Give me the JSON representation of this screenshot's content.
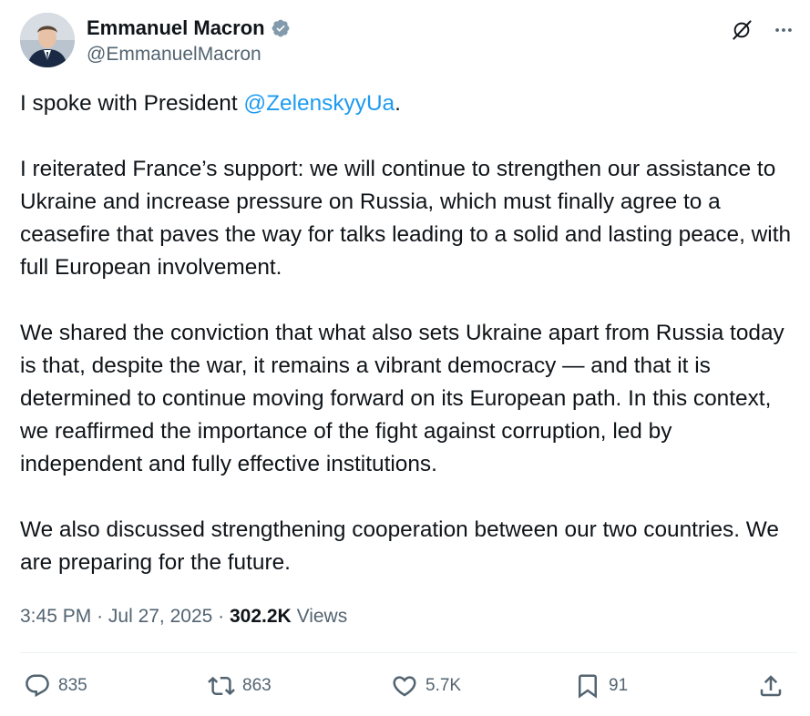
{
  "author": {
    "display_name": "Emmanuel Macron",
    "handle": "@EmmanuelMacron",
    "verified": true,
    "avatar_icon": "avatar"
  },
  "tweet": {
    "p1_prefix": "I spoke with President ",
    "p1_mention": "@ZelenskyyUa",
    "p1_suffix": ".",
    "p2": "I reiterated France’s support: we will continue to strengthen our assistance to Ukraine and increase pressure on Russia, which must finally agree to a ceasefire that paves the way for talks leading to a solid and lasting peace, with full European involvement.",
    "p3": "We shared the conviction that what also sets Ukraine apart from Russia today is that, despite the war, it remains a vibrant democracy — and that it is determined to continue moving forward on its European path. In this context, we reaffirmed the importance of the fight against corruption, led by independent and fully effective institutions.",
    "p4": "We also discussed strengthening cooperation between our two countries. We are preparing for the future."
  },
  "meta": {
    "time": "3:45 PM",
    "date": "Jul 27, 2025",
    "views_count": "302.2K",
    "views_label": "Views"
  },
  "actions": {
    "replies": "835",
    "reposts": "863",
    "likes": "5.7K",
    "bookmarks": "91"
  },
  "colors": {
    "accent": "#1d9bf0",
    "text": "#0f1419",
    "muted": "#536471"
  }
}
